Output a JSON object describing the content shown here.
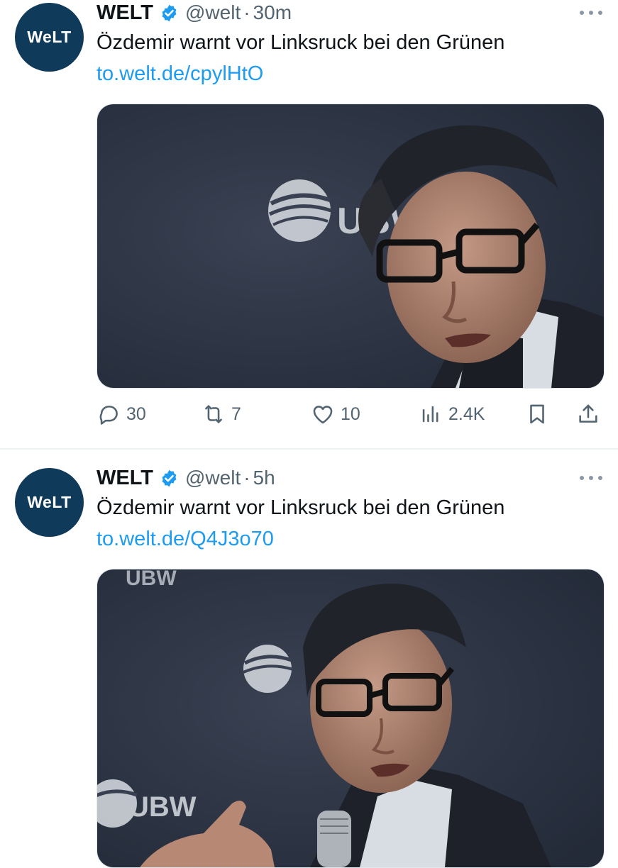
{
  "tweets": [
    {
      "avatar_text": "WeLT",
      "name": "WELT",
      "handle": "@welt",
      "separator": "·",
      "time": "30m",
      "text": "Özdemir warnt vor Linksruck bei den Grünen",
      "link": "to.welt.de/cpylHtO",
      "image_logo_text": "UBW",
      "actions": {
        "replies": "30",
        "retweets": "7",
        "likes": "10",
        "views": "2.4K"
      }
    },
    {
      "avatar_text": "WeLT",
      "name": "WELT",
      "handle": "@welt",
      "separator": "·",
      "time": "5h",
      "text": "Özdemir warnt vor Linksruck bei den Grünen",
      "link": "to.welt.de/Q4J3o70",
      "image_logo_text": "UBW"
    }
  ],
  "colors": {
    "avatar_bg": "#0f3a5a",
    "link": "#1d9bf0",
    "verified": "#1d9bf0",
    "muted": "#536471",
    "image_bg": "#2b3242"
  },
  "icons": [
    "verified-badge-icon",
    "more-options-icon",
    "reply-icon",
    "retweet-icon",
    "like-icon",
    "views-icon",
    "bookmark-icon",
    "share-icon"
  ]
}
